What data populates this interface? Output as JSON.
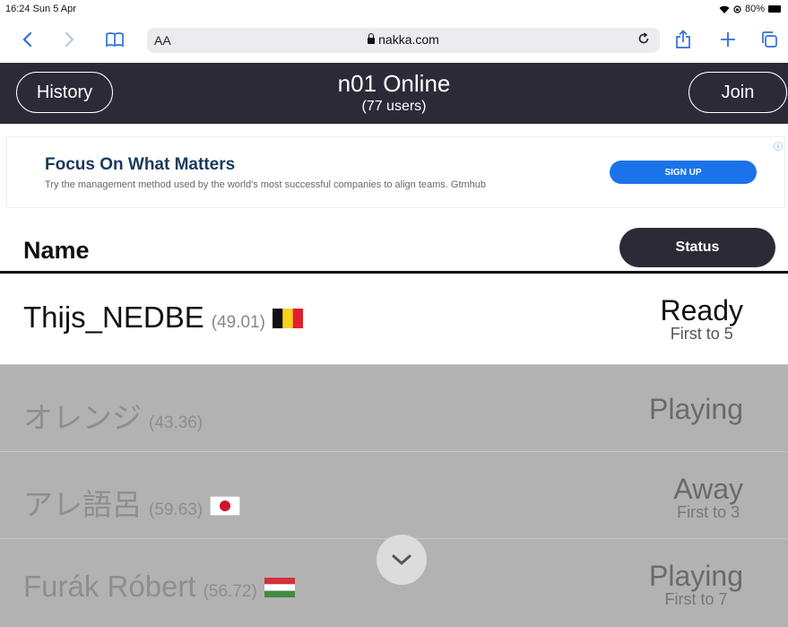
{
  "status_bar": {
    "time_date": "16:24  Sun 5 Apr",
    "battery": "80%"
  },
  "browser": {
    "text_size_label": "AA",
    "url": "nakka.com",
    "icons": [
      "back-icon",
      "forward-icon",
      "bookmarks-icon",
      "reload-icon",
      "share-icon",
      "new-tab-icon",
      "tabs-icon"
    ]
  },
  "header": {
    "history_label": "History",
    "title": "n01 Online",
    "subtitle": "(77 users)",
    "join_label": "Join",
    "bg_color": "#2d2a38"
  },
  "ad": {
    "headline": "Focus On What Matters",
    "text": "Try the management method used by the world's most successful companies to align teams. Gtmhub",
    "cta": "SIGN UP"
  },
  "table": {
    "name_header": "Name",
    "status_header": "Status",
    "rows": [
      {
        "name": "Thijs_NEDBE",
        "rating": "(49.01)",
        "flag": "belgium",
        "status": "Ready",
        "sub": "First to 5"
      },
      {
        "name": "オレンジ",
        "rating": "(43.36)",
        "flag": "",
        "status": "Playing",
        "sub": ""
      },
      {
        "name": "アレ語呂",
        "rating": "(59.63)",
        "flag": "japan",
        "status": "Away",
        "sub": "First to 3"
      },
      {
        "name": "Furák Róbert",
        "rating": "(56.72)",
        "flag": "hungary",
        "status": "Playing",
        "sub": "First to 7"
      }
    ]
  }
}
